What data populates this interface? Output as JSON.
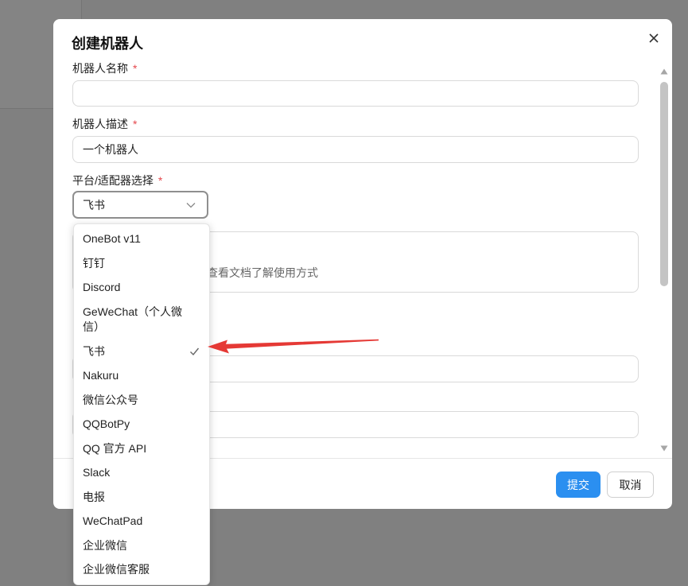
{
  "colors": {
    "accent": "#2b8ff0",
    "required": "#e5484d",
    "arrow": "#e53935",
    "overlay": "#808080"
  },
  "modal": {
    "title": "创建机器人",
    "close_icon": "close-icon",
    "fields": {
      "name": {
        "label": "机器人名称",
        "required_mark": "*",
        "value": ""
      },
      "description": {
        "label": "机器人描述",
        "required_mark": "*",
        "value": "一个机器人"
      },
      "platform": {
        "label": "平台/适配器选择",
        "required_mark": "*",
        "value": "飞书",
        "icon": "chevron-down-icon"
      }
    },
    "hint_text": "查看文档了解使用方式",
    "footer": {
      "submit_label": "提交",
      "cancel_label": "取消"
    }
  },
  "dropdown": {
    "selected": "飞书",
    "check_icon": "check-icon",
    "options": [
      {
        "label": "OneBot v11"
      },
      {
        "label": "钉钉"
      },
      {
        "label": "Discord"
      },
      {
        "label": "GeWeChat（个人微信）"
      },
      {
        "label": "飞书"
      },
      {
        "label": "Nakuru"
      },
      {
        "label": "微信公众号"
      },
      {
        "label": "QQBotPy"
      },
      {
        "label": "QQ 官方 API"
      },
      {
        "label": "Slack"
      },
      {
        "label": "电报"
      },
      {
        "label": "WeChatPad"
      },
      {
        "label": "企业微信"
      },
      {
        "label": "企业微信客服"
      }
    ]
  },
  "annotation": {
    "arrow_icon": "red-arrow-icon",
    "points_to": "飞书"
  }
}
